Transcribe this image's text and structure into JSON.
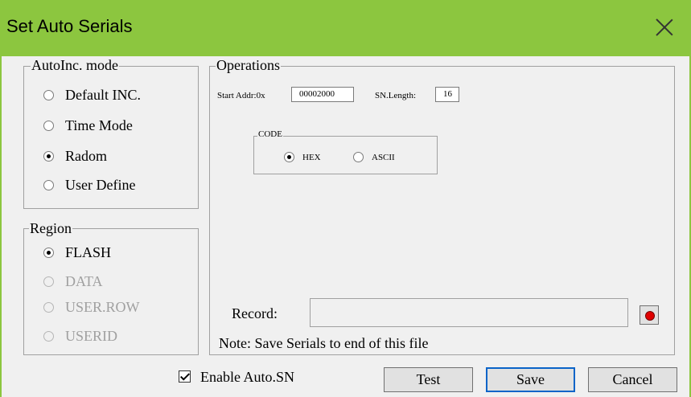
{
  "window": {
    "title": "Set Auto Serials",
    "accent_color": "#8cc63f"
  },
  "autoinc": {
    "legend": "AutoInc. mode",
    "options": [
      {
        "label": "Default INC.",
        "selected": false
      },
      {
        "label": "Time Mode",
        "selected": false
      },
      {
        "label": "Radom",
        "selected": true
      },
      {
        "label": "User Define",
        "selected": false
      }
    ]
  },
  "region": {
    "legend": "Region",
    "options": [
      {
        "label": "FLASH",
        "selected": true,
        "enabled": true
      },
      {
        "label": "DATA",
        "selected": false,
        "enabled": false
      },
      {
        "label": "USER.ROW",
        "selected": false,
        "enabled": false
      },
      {
        "label": "USERID",
        "selected": false,
        "enabled": false
      }
    ]
  },
  "operations": {
    "legend": "Operations",
    "start_addr_label": "Start Addr:0x",
    "start_addr_value": "00002000",
    "sn_length_label": "SN.Length:",
    "sn_length_value": "16",
    "code": {
      "legend": "CODE",
      "options": [
        {
          "label": "HEX",
          "selected": true
        },
        {
          "label": "ASCII",
          "selected": false
        }
      ]
    },
    "record_label": "Record:",
    "record_value": "",
    "record_button_icon": "record-icon",
    "note": "Note: Save Serials to end of this file"
  },
  "footer": {
    "enable_label": "Enable Auto.SN",
    "enable_checked": true,
    "test_label": "Test",
    "save_label": "Save",
    "cancel_label": "Cancel"
  }
}
